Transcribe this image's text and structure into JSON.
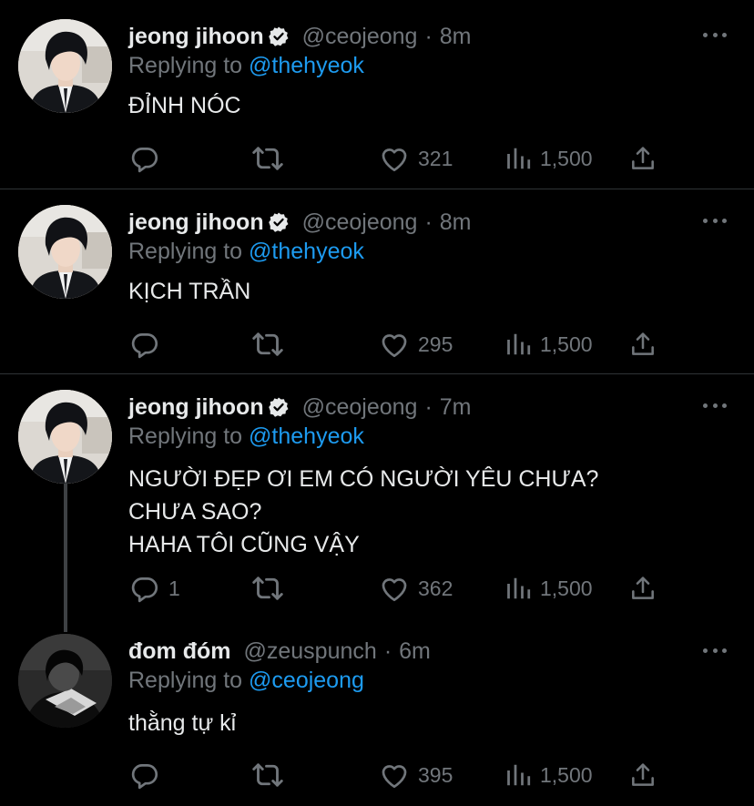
{
  "colors": {
    "background": "#000000",
    "text": "#e7e9ea",
    "secondary": "#71767b",
    "link": "#1d9bf0",
    "divider": "#2f3336"
  },
  "tweets": [
    {
      "name": "jeong jihoon",
      "verified": true,
      "handle": "@ceojeong",
      "dot": "·",
      "time": "8m",
      "replying_label": "Replying to",
      "replying_to": "@thehyeok",
      "lines": [
        "ĐỈNH NÓC"
      ],
      "reply_count": "",
      "likes": "321",
      "views": "1,500"
    },
    {
      "name": "jeong jihoon",
      "verified": true,
      "handle": "@ceojeong",
      "dot": "·",
      "time": "8m",
      "replying_label": "Replying to",
      "replying_to": "@thehyeok",
      "lines": [
        "KỊCH TRẦN"
      ],
      "reply_count": "",
      "likes": "295",
      "views": "1,500"
    },
    {
      "name": "jeong jihoon",
      "verified": true,
      "handle": "@ceojeong",
      "dot": "·",
      "time": "7m",
      "replying_label": "Replying to",
      "replying_to": "@thehyeok",
      "lines": [
        "NGƯỜI ĐẸP ƠI EM CÓ NGƯỜI YÊU CHƯA?",
        "CHƯA SAO?",
        "HAHA TÔI CŨNG VẬY"
      ],
      "reply_count": "1",
      "likes": "362",
      "views": "1,500"
    },
    {
      "name": "đom đóm",
      "verified": false,
      "handle": "@zeuspunch",
      "dot": "·",
      "time": "6m",
      "replying_label": "Replying to",
      "replying_to": "@ceojeong",
      "lines": [
        "thằng tự kỉ"
      ],
      "reply_count": "",
      "likes": "395",
      "views": "1,500"
    }
  ],
  "icons": {
    "reply": "reply-icon",
    "retweet": "retweet-icon",
    "like": "heart-icon",
    "views": "views-icon",
    "share": "share-icon",
    "more": "more-icon",
    "verified": "verified-badge-icon"
  }
}
